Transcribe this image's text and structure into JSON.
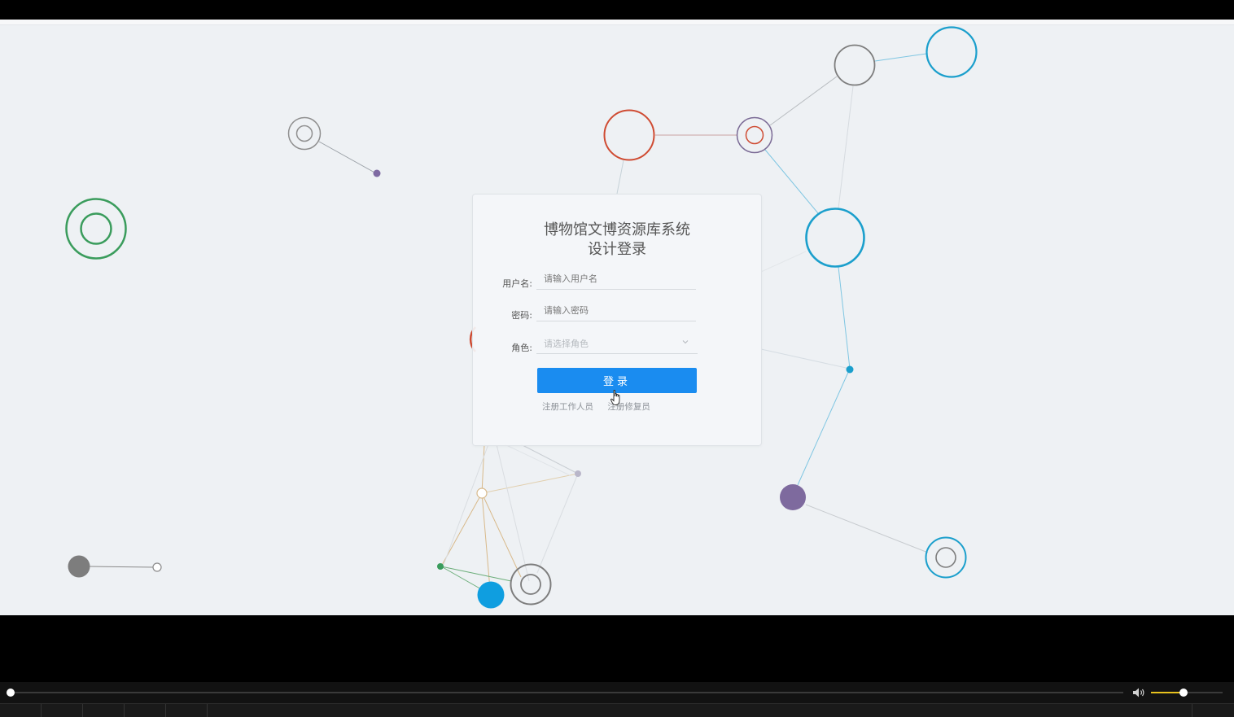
{
  "login": {
    "title_line1": "博物馆文博资源库系统",
    "title_line2": "设计登录",
    "username_label": "用户名:",
    "username_placeholder": "请输入用户名",
    "password_label": "密码:",
    "password_placeholder": "请输入密码",
    "role_label": "角色:",
    "role_placeholder": "请选择角色",
    "submit_label": "登录",
    "register_staff_link": "注册工作人员",
    "register_restorer_link": "注册修复员"
  },
  "player": {
    "progress": 0.0,
    "volume": 0.45
  },
  "colors": {
    "accent": "#1a8cf0",
    "background": "#eef1f4",
    "volume": "#e8c21e"
  },
  "icons": {
    "dropdown": "chevron-down-icon",
    "cursor": "cursor-icon",
    "volume": "volume-icon"
  }
}
